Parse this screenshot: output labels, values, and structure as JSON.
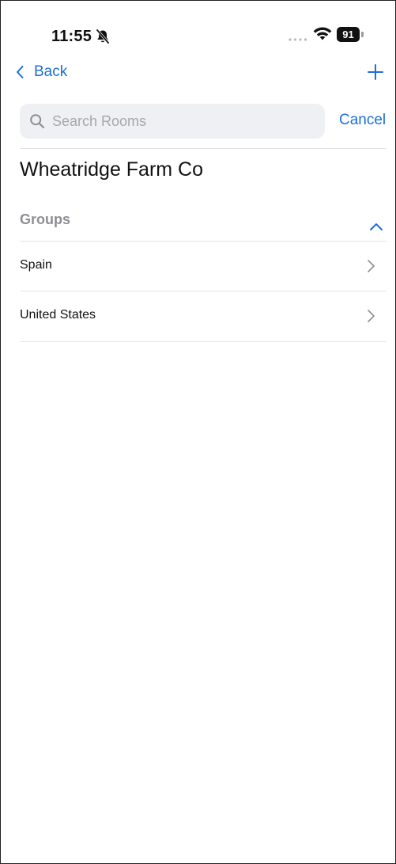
{
  "status_bar": {
    "time": "11:55",
    "battery": "91"
  },
  "nav": {
    "back_label": "Back"
  },
  "search": {
    "placeholder": "Search Rooms",
    "value": "",
    "cancel_label": "Cancel"
  },
  "org": {
    "title": "Wheatridge Farm Co"
  },
  "groups": {
    "header": "Groups",
    "expanded": true,
    "items": [
      {
        "label": "Spain"
      },
      {
        "label": "United States"
      }
    ]
  },
  "colors": {
    "accent": "#1d6fd6",
    "section_header": "#8d8f94",
    "search_bg": "#eff0f3",
    "divider": "#e3e3e6"
  }
}
